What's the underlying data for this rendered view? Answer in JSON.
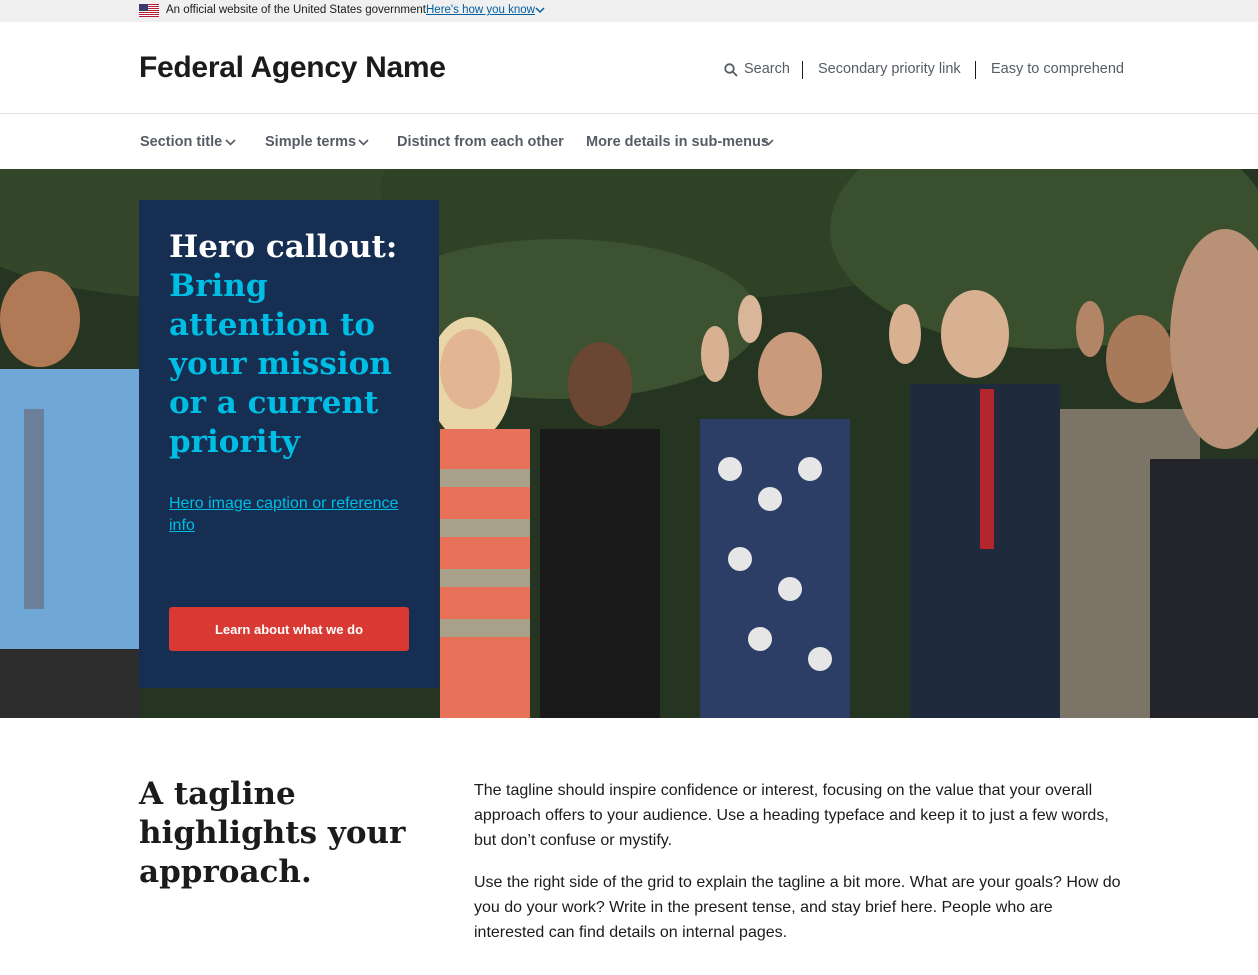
{
  "gov_banner": {
    "official_text": "An official website of the United States government",
    "how_you_know_link": "Here's how you know",
    "flag_icon": "us-flag-icon"
  },
  "header": {
    "agency_name": "Federal Agency Name",
    "utility_links": {
      "search": "Search",
      "secondary": "Secondary priority link",
      "easy": "Easy to comprehend"
    }
  },
  "nav": {
    "items": [
      {
        "label": "Section title",
        "has_submenu": true
      },
      {
        "label": "Simple terms",
        "has_submenu": true
      },
      {
        "label": "Distinct from each other",
        "has_submenu": false
      },
      {
        "label": "More details in sub-menus",
        "has_submenu": true
      }
    ]
  },
  "hero": {
    "callout_lead": "Hero callout:",
    "callout_body": "Bring attention to your mission or a current priority",
    "caption_link": "Hero image caption or reference info",
    "cta_button": "Learn about what we do"
  },
  "tagline": {
    "heading": "A tagline highlights your approach.",
    "paragraph1": "The tagline should inspire confidence or interest, focusing on the value that your overall approach offers to your audience. Use a heading typeface and keep it to just a few words, but don’t confuse or mystify.",
    "paragraph2": "Use the right side of the grid to explain the tagline a bit more. What are your goals? How do you do your work? Write in the present tense, and stay brief here. People who are interested can find details on internal pages."
  },
  "colors": {
    "callout_bg": "#162e51",
    "callout_accent": "#00bde3",
    "cta_red": "#d83933",
    "link_blue": "#005ea2",
    "banner_bg": "#f0f0f0"
  }
}
